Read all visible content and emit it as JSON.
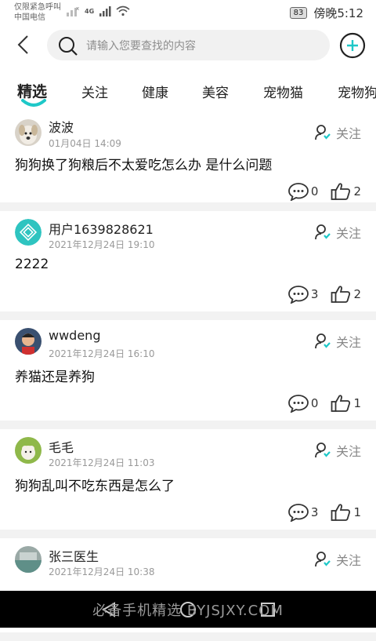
{
  "status_bar": {
    "emergency_text": "仅限紧急呼叫",
    "carrier": "中国电信",
    "network": "4G",
    "battery": "83",
    "time": "傍晚5:12"
  },
  "header": {
    "search_placeholder": "请输入您要查找的内容"
  },
  "tabs": [
    {
      "label": "精选",
      "active": true
    },
    {
      "label": "关注",
      "active": false
    },
    {
      "label": "健康",
      "active": false
    },
    {
      "label": "美容",
      "active": false
    },
    {
      "label": "宠物猫",
      "active": false
    },
    {
      "label": "宠物狗",
      "active": false
    }
  ],
  "accent_color": "#1ec8c8",
  "posts": [
    {
      "name": "波波",
      "time": "01月04日 14:09",
      "content": "狗狗换了狗粮后不太爱吃怎么办 是什么问题",
      "comments": "0",
      "likes": "2",
      "follow": "关注",
      "avatar": "dog-photo"
    },
    {
      "name": "用户1639828621",
      "time": "2021年12月24日 19:10",
      "content": "2222",
      "comments": "3",
      "likes": "2",
      "follow": "关注",
      "avatar": "teal-logo"
    },
    {
      "name": "wwdeng",
      "time": "2021年12月24日 16:10",
      "content": "养猫还是养狗",
      "comments": "0",
      "likes": "1",
      "follow": "关注",
      "avatar": "child-photo"
    },
    {
      "name": "毛毛",
      "time": "2021年12月24日 11:03",
      "content": "狗狗乱叫不吃东西是怎么了",
      "comments": "3",
      "likes": "1",
      "follow": "关注",
      "avatar": "puppy-photo"
    },
    {
      "name": "张三医生",
      "time": "2021年12月24日 10:38",
      "content": "",
      "comments": "",
      "likes": "",
      "follow": "关注",
      "avatar": "clinic-photo"
    }
  ],
  "watermark": "必备手机精选 BYJSJXY.COM"
}
